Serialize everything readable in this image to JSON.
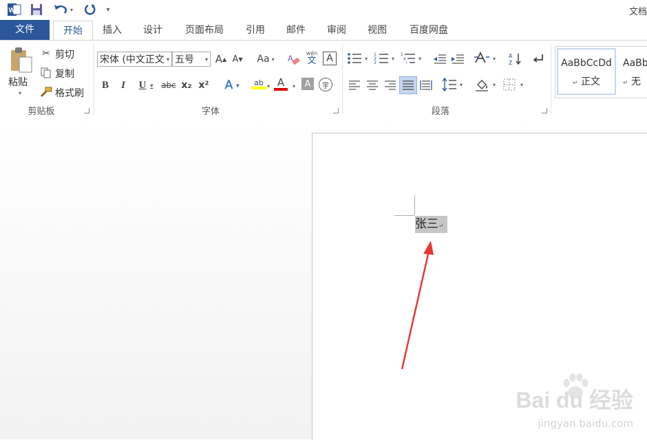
{
  "title_bar": {
    "doc_title": "文档",
    "customize_arrow": "▾"
  },
  "tabs": [
    {
      "label": "文件"
    },
    {
      "label": "开始"
    },
    {
      "label": "插入"
    },
    {
      "label": "设计"
    },
    {
      "label": "页面布局"
    },
    {
      "label": "引用"
    },
    {
      "label": "邮件"
    },
    {
      "label": "审阅"
    },
    {
      "label": "视图"
    },
    {
      "label": "百度网盘"
    }
  ],
  "clipboard": {
    "paste_label": "粘贴",
    "cut_label": "剪切",
    "copy_label": "复制",
    "format_painter_label": "格式刷",
    "group_label": "剪贴板"
  },
  "font": {
    "font_name": "宋体 (中文正文",
    "font_size": "五号",
    "grow_label": "A",
    "shrink_label": "A",
    "case_label": "Aa",
    "phonetic_top": "wén",
    "phonetic_bottom": "文",
    "border_char_label": "A",
    "bold_label": "B",
    "italic_label": "I",
    "underline_label": "U",
    "strike_label": "abc",
    "sub_label": "x₂",
    "sup_label": "x²",
    "effects_label": "A",
    "highlight_label": "ab",
    "font_color_label": "A",
    "shade_label": "A",
    "enclose_label": "字",
    "group_label": "字体",
    "highlight_color": "#ffff00",
    "font_color": "#e00000"
  },
  "paragraph": {
    "group_label": "段落"
  },
  "styles": {
    "items": [
      {
        "sample": "AaBbCcDd",
        "name": "正文"
      },
      {
        "sample": "AaBb",
        "name": "无"
      }
    ],
    "para_mark": "↵"
  },
  "document": {
    "text": "张三",
    "para_mark": "↵"
  },
  "watermark": {
    "brand": "Bai du 经验",
    "url": "jingyan.baidu.com"
  },
  "colors": {
    "accent": "#2b579a",
    "arrow": "#e53935"
  }
}
